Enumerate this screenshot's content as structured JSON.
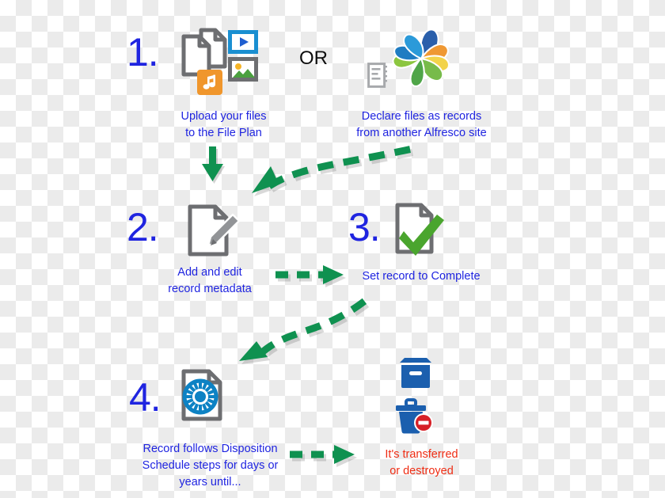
{
  "diagram": {
    "title_text_color": "#1f24e0",
    "accent_green": "#0f9150",
    "accent_red": "#ef2c13",
    "accent_blue": "#0d6fb8",
    "doc_gray": "#6d6e71",
    "connector_or_label": "OR",
    "steps": [
      {
        "number": "1.",
        "caption_line1": "Upload your files",
        "caption_line2": "to the File Plan",
        "icons": [
          "documents-icon",
          "video-file-icon",
          "image-file-icon",
          "music-file-icon"
        ]
      },
      {
        "number": "2.",
        "caption_line1": "Add and edit",
        "caption_line2": "record metadata",
        "icons": [
          "document-edit-icon"
        ]
      },
      {
        "number": "3.",
        "caption_line1": "Set record to Complete",
        "caption_line2": "",
        "icons": [
          "document-check-icon"
        ]
      },
      {
        "number": "4.",
        "caption_line1": "Record follows Disposition",
        "caption_line2": "Schedule steps for days or",
        "caption_line3": "years until...",
        "icons": [
          "document-gear-icon"
        ]
      }
    ],
    "alternate_branch": {
      "caption_line1": "Declare files as records",
      "caption_line2": "from another Alfresco site",
      "icons": [
        "ledger-icon",
        "alfresco-logo-icon"
      ]
    },
    "outcome": {
      "caption_line1": "It's transferred",
      "caption_line2": "or destroyed",
      "icons": [
        "archive-box-icon",
        "trash-delete-icon"
      ]
    },
    "arrows": [
      {
        "name": "arrow-down-step1-to-step2",
        "style": "solid-down"
      },
      {
        "name": "arrow-curved-alfresco-to-step2",
        "style": "dashed-curve-left"
      },
      {
        "name": "arrow-step2-to-step3",
        "style": "dashed-right"
      },
      {
        "name": "arrow-curved-step3-to-step4",
        "style": "dashed-curve-down-left"
      },
      {
        "name": "arrow-step4-to-outcome",
        "style": "dashed-right"
      }
    ]
  }
}
